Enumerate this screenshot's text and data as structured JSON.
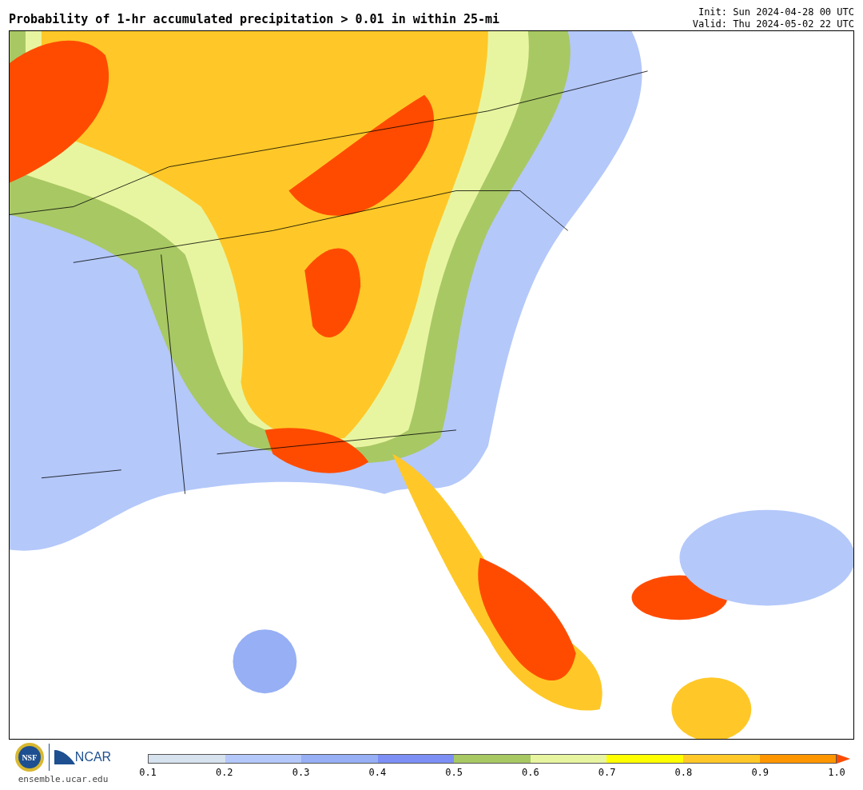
{
  "title": "Probability of 1-hr accumulated precipitation > 0.01 in within 25-mi",
  "init": "Init: Sun 2024-04-28 00 UTC",
  "valid": "Valid: Thu 2024-05-02 22 UTC",
  "logos": {
    "nsf": "NSF",
    "ncar": "NCAR",
    "url": "ensemble.ucar.edu"
  },
  "colorbar": {
    "segments": [
      {
        "kind": "band",
        "color": "#d6e2ee"
      },
      {
        "kind": "band",
        "color": "#b4c8fa"
      },
      {
        "kind": "band",
        "color": "#96aff5"
      },
      {
        "kind": "band",
        "color": "#7d8ff5"
      },
      {
        "kind": "band",
        "color": "#a8c864"
      },
      {
        "kind": "band",
        "color": "#e8f5a0"
      },
      {
        "kind": "band",
        "color": "#ffff00"
      },
      {
        "kind": "band",
        "color": "#ffc828"
      },
      {
        "kind": "band",
        "color": "#ff9600"
      },
      {
        "kind": "arrow",
        "color": "#ff4b00"
      }
    ],
    "ticks": [
      "0.1",
      "0.2",
      "0.3",
      "0.4",
      "0.5",
      "0.6",
      "0.7",
      "0.8",
      "0.9",
      "1.0"
    ]
  }
}
